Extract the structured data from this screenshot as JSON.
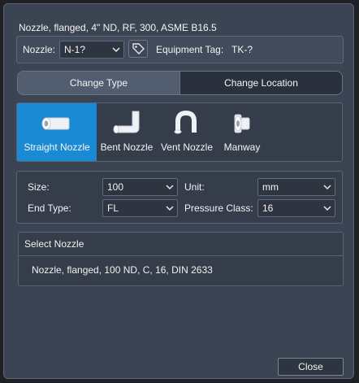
{
  "dialog": {
    "title": "Nozzle, flanged, 4\" ND, RF, 300, ASME B16.5"
  },
  "nozzle_bar": {
    "nozzle_label": "Nozzle:",
    "nozzle_value": "N-1?",
    "tag_icon": "tag-icon",
    "equipment_label": "Equipment Tag:",
    "equipment_value": "TK-?"
  },
  "segments": {
    "change_type": "Change Type",
    "change_location": "Change Location",
    "active": "change_type"
  },
  "nozzle_types": {
    "selected": "straight",
    "items": [
      {
        "id": "straight",
        "label": "Straight Nozzle",
        "icon": "straight-nozzle-icon"
      },
      {
        "id": "bent",
        "label": "Bent Nozzle",
        "icon": "bent-nozzle-icon"
      },
      {
        "id": "vent",
        "label": "Vent Nozzle",
        "icon": "vent-nozzle-icon"
      },
      {
        "id": "manway",
        "label": "Manway",
        "icon": "manway-icon"
      }
    ]
  },
  "properties": {
    "size_label": "Size:",
    "size_value": "100",
    "unit_label": "Unit:",
    "unit_value": "mm",
    "end_type_label": "End Type:",
    "end_type_value": "FL",
    "pressure_class_label": "Pressure Class:",
    "pressure_class_value": "16"
  },
  "select_nozzle": {
    "header": "Select Nozzle",
    "items": [
      "Nozzle, flanged, 100 ND, C, 16, DIN 2633"
    ]
  },
  "footer": {
    "close_label": "Close"
  },
  "colors": {
    "dialog_bg": "#3b4453",
    "accent": "#1b8ad4",
    "input_bg": "#2e3440"
  }
}
